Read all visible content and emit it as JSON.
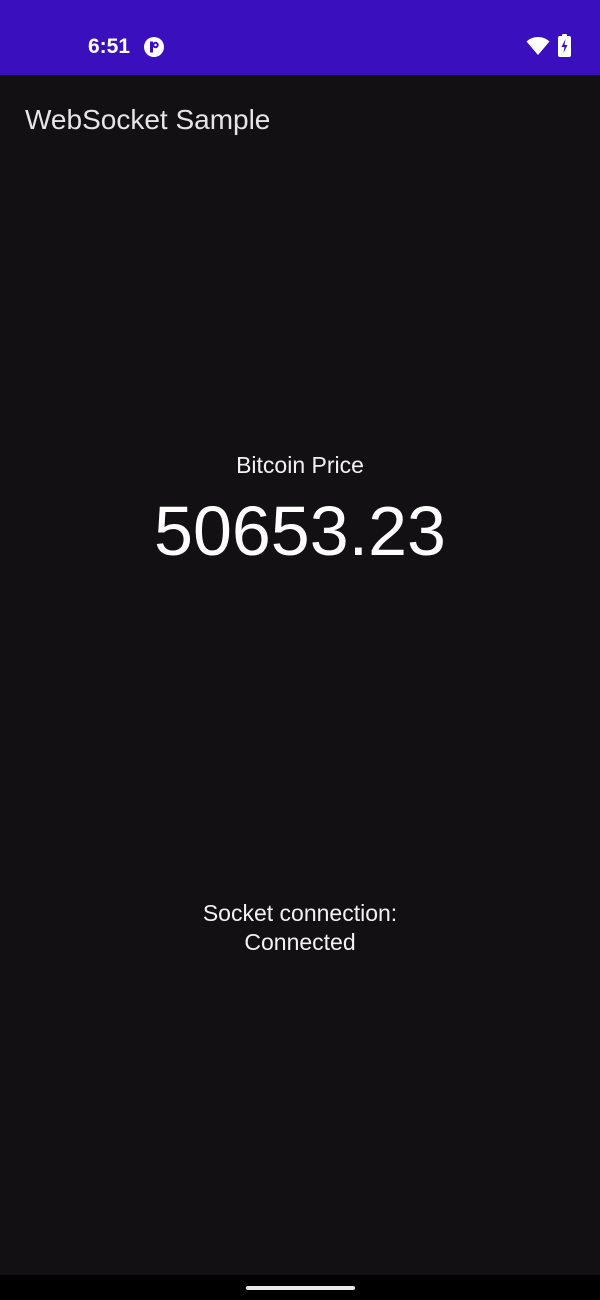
{
  "status_bar": {
    "time": "6:51",
    "icons": [
      "app-notification-icon",
      "wifi-icon",
      "battery-charging-icon"
    ],
    "background": "#3a0fbe"
  },
  "app_bar": {
    "title": "WebSocket Sample"
  },
  "ticker": {
    "label": "Bitcoin Price",
    "value": "50653.23"
  },
  "connection": {
    "label": "Socket connection:",
    "state": "Connected"
  },
  "theme": {
    "background": "#121012",
    "text": "#ffffff"
  }
}
